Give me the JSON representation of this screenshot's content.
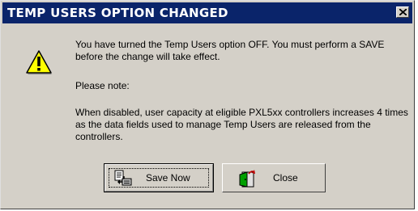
{
  "dialog": {
    "title": "TEMP USERS OPTION CHANGED",
    "close_icon": "close-icon",
    "icon": "warning-icon",
    "message_1": "You have turned the Temp Users option OFF.  You must perform a SAVE before the change will take effect.",
    "message_2": "Please note:",
    "message_3": "When disabled, user capacity at eligible PXL5xx controllers increases 4 times as the data fields used to manage Temp Users are released from the controllers."
  },
  "buttons": {
    "save_label": "Save Now",
    "save_icon": "save-document-icon",
    "close_label": "Close",
    "close_icon": "exit-door-icon"
  },
  "colors": {
    "titlebar": "#0a246a",
    "face": "#d4d0c8",
    "warning": "#ffff00"
  }
}
